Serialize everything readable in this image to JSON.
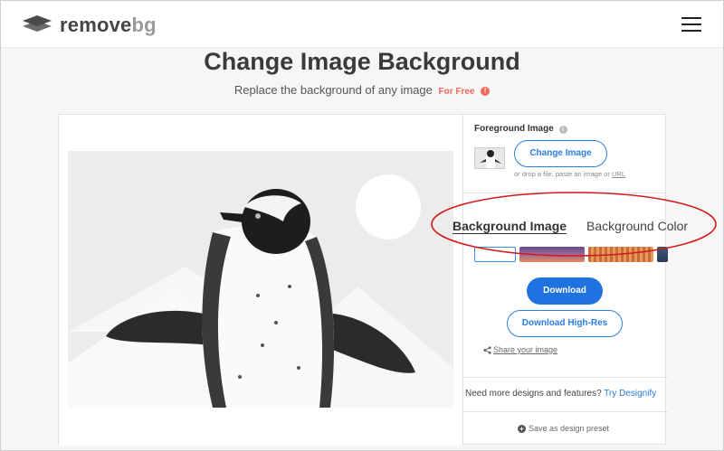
{
  "header": {
    "logo_text_main": "remove",
    "logo_text_accent": "bg"
  },
  "page": {
    "title": "Change Image Background",
    "subtitle": "Replace the background of any image",
    "free_label": "For Free",
    "free_info": "!"
  },
  "panel": {
    "foreground_label": "Foreground Image",
    "foreground_info": "i",
    "change_button": "Change Image",
    "drop_hint": "or drop a file, paste an image or",
    "drop_hint_url": "URL",
    "tabs": [
      {
        "label": "Background Image",
        "active": true
      },
      {
        "label": "Background Color",
        "active": false
      }
    ],
    "download_button": "Download",
    "download_hr_button": "Download High-Res",
    "share_label": "Share your image",
    "more_text": "Need more designs and features?",
    "more_link": "Try Designify",
    "preset_icon": "+",
    "preset_label": "Save as design preset"
  },
  "colors": {
    "accent": "#1f73e0",
    "free_red": "#f0675b",
    "annotation_red": "#d11b1b"
  },
  "icons": [
    "logo-layers-icon",
    "hamburger-menu-icon",
    "info-icon",
    "share-icon",
    "plus-circle-icon"
  ]
}
